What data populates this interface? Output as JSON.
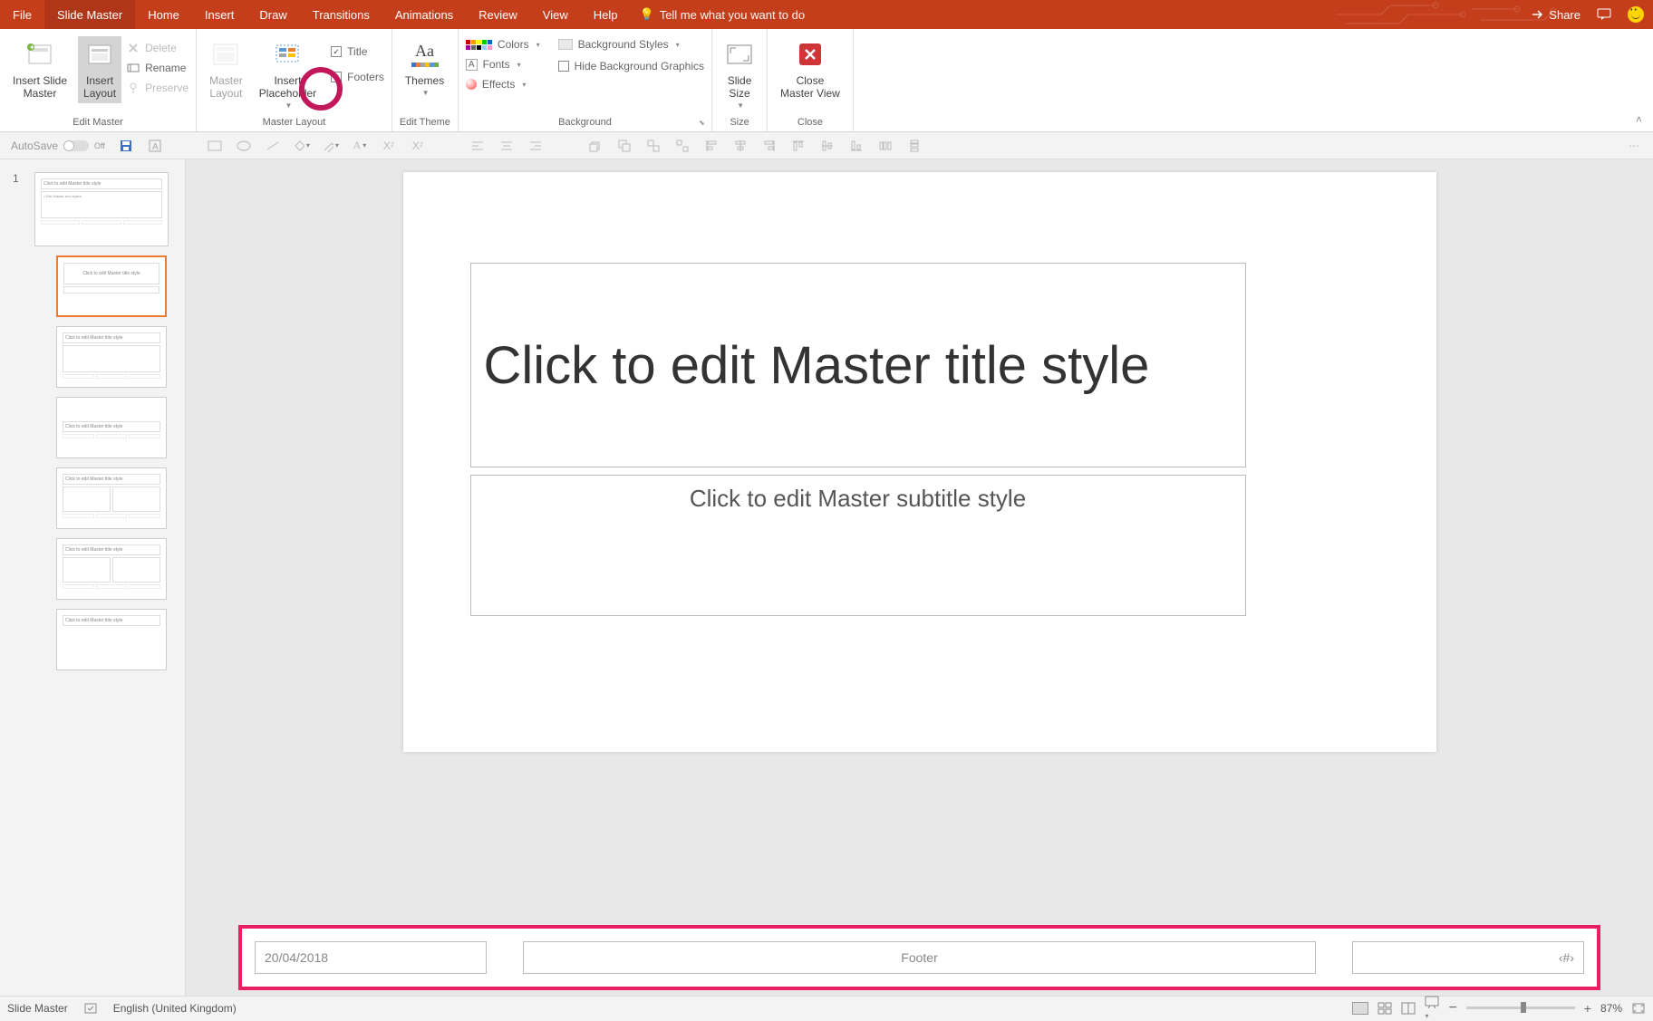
{
  "tabs": {
    "file": "File",
    "slide_master": "Slide Master",
    "home": "Home",
    "insert": "Insert",
    "draw": "Draw",
    "transitions": "Transitions",
    "animations": "Animations",
    "review": "Review",
    "view": "View",
    "help": "Help"
  },
  "tell_me": "Tell me what you want to do",
  "share": "Share",
  "ribbon": {
    "edit_master": {
      "insert_slide_master": "Insert Slide\nMaster",
      "insert_layout": "Insert\nLayout",
      "delete": "Delete",
      "rename": "Rename",
      "preserve": "Preserve",
      "label": "Edit Master"
    },
    "master_layout": {
      "master_layout": "Master\nLayout",
      "insert_placeholder": "Insert\nPlaceholder",
      "title": "Title",
      "footers": "Footers",
      "label": "Master Layout"
    },
    "edit_theme": {
      "themes": "Themes",
      "label": "Edit Theme"
    },
    "background": {
      "colors": "Colors",
      "fonts": "Fonts",
      "effects": "Effects",
      "background_styles": "Background Styles",
      "hide_background": "Hide Background Graphics",
      "label": "Background"
    },
    "size": {
      "slide_size": "Slide\nSize",
      "label": "Size"
    },
    "close": {
      "close_master_view": "Close\nMaster View",
      "label": "Close"
    }
  },
  "autosave": "AutoSave",
  "autosave_state": "Off",
  "slide": {
    "title": "Click to edit Master title style",
    "subtitle": "Click to edit Master subtitle style"
  },
  "footer": {
    "date": "20/04/2018",
    "center": "Footer",
    "pagenum": "‹#›"
  },
  "thumbnails": {
    "slide_number": "1",
    "master_title": "Click to edit Master title style",
    "layout_title": "Click to edit Master title style",
    "bullet_preview": "• Edit Master text styles"
  },
  "statusbar": {
    "mode": "Slide Master",
    "language": "English (United Kingdom)",
    "zoom": "87%"
  },
  "subscript": "X",
  "superscript": "X"
}
